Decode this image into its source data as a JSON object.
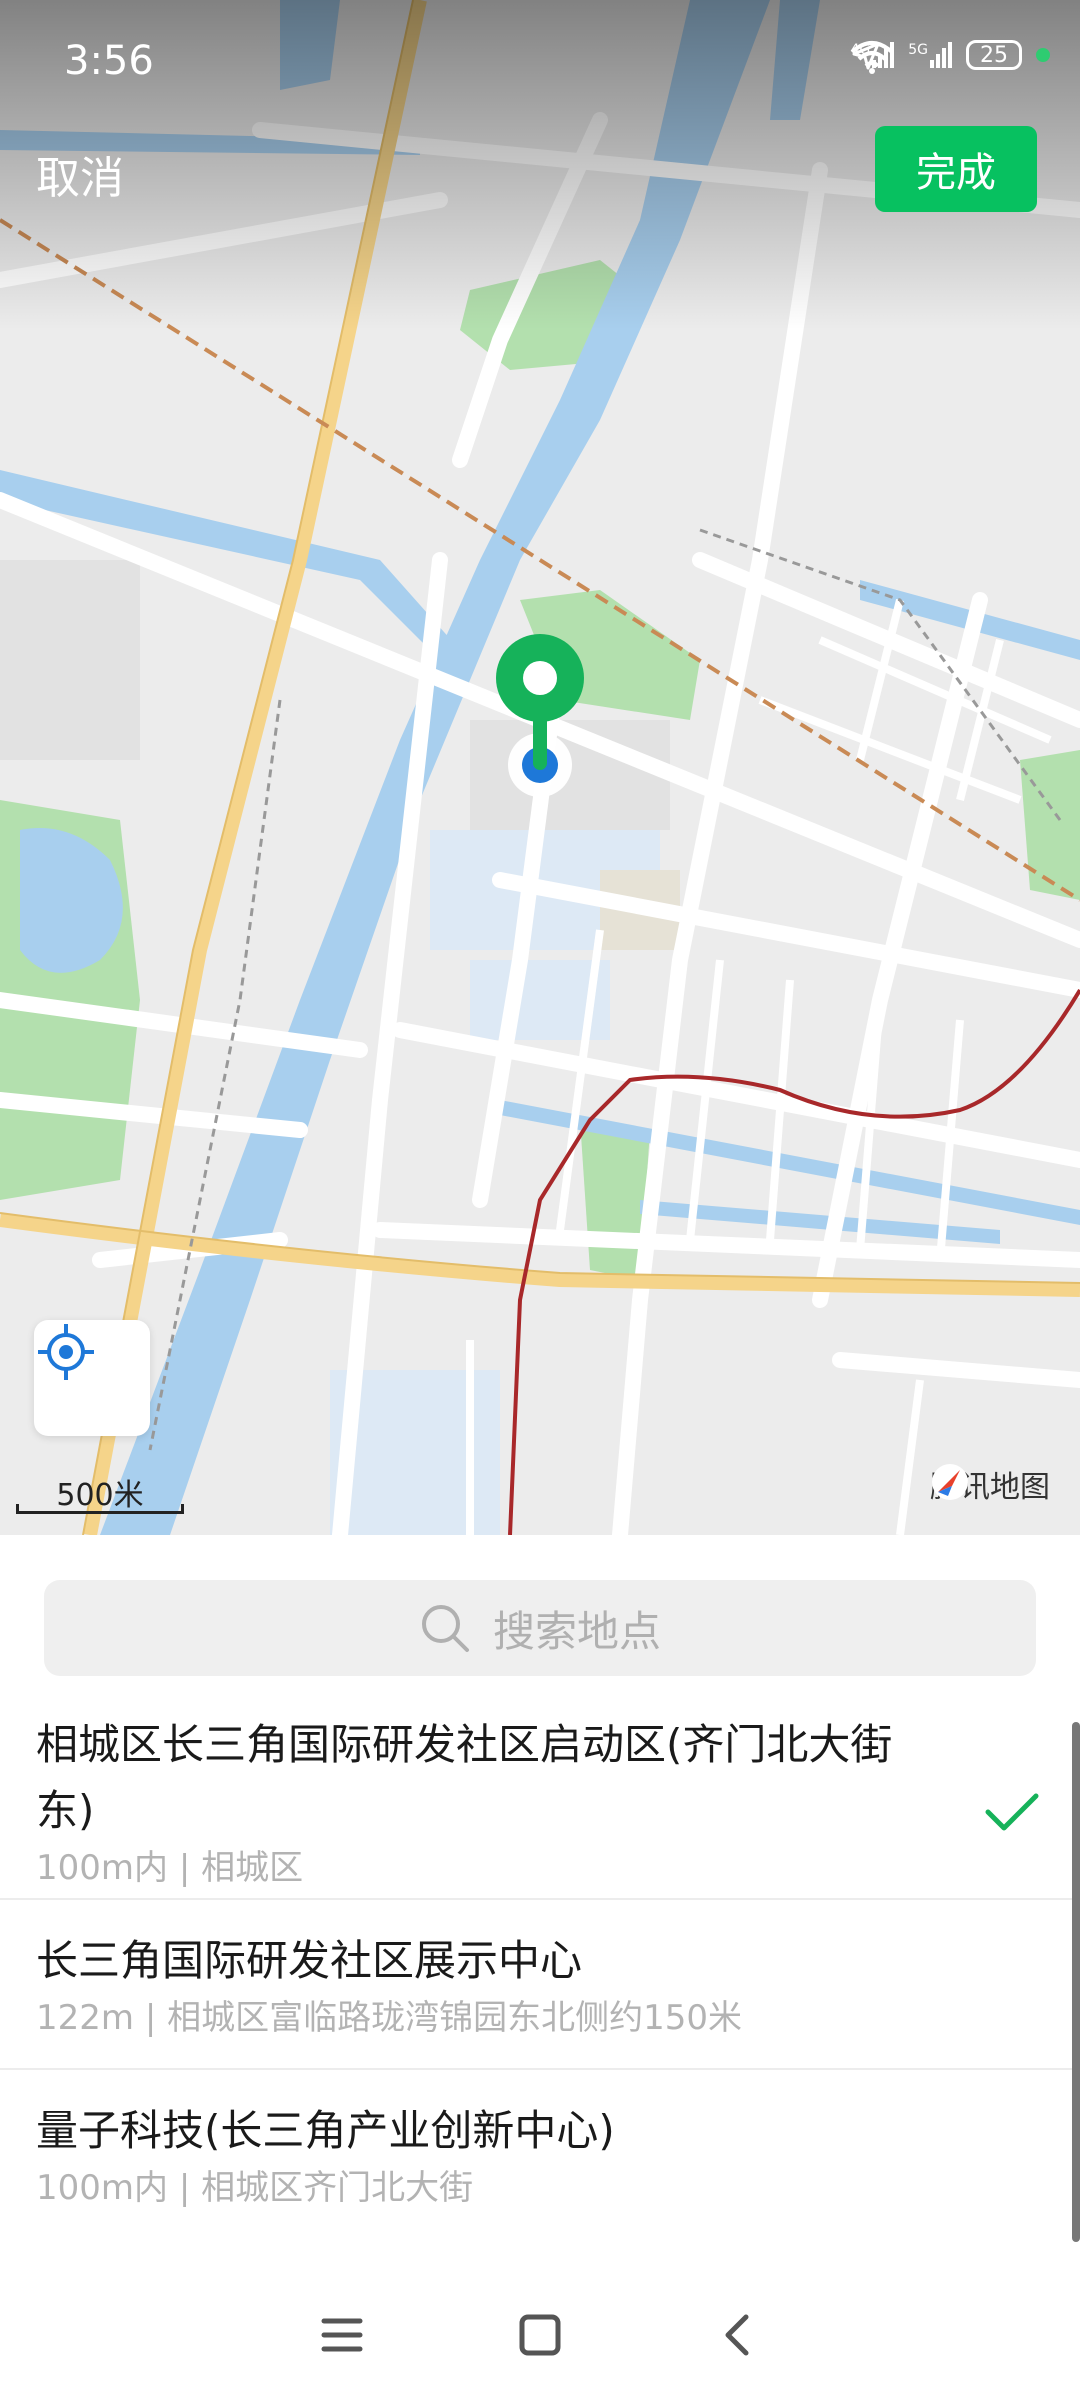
{
  "status_bar": {
    "time": "3:56",
    "signal_1": "4G",
    "signal_2": "5G",
    "battery": "25"
  },
  "header": {
    "cancel_label": "取消",
    "done_label": "完成"
  },
  "map": {
    "scale_label": "500米",
    "provider": "腾讯地图"
  },
  "search": {
    "placeholder": "搜索地点"
  },
  "results": [
    {
      "title": "相城区长三角国际研发社区启动区(齐门北大街东)",
      "subtitle": "100m内 | 相城区",
      "selected": true
    },
    {
      "title": "长三角国际研发社区展示中心",
      "subtitle": "122m | 相城区富临路珑湾锦园东北侧约150米",
      "selected": false
    },
    {
      "title": "量子科技(长三角产业创新中心)",
      "subtitle": "100m内 | 相城区齐门北大街",
      "selected": false
    }
  ],
  "colors": {
    "accent": "#07c160",
    "water": "#a8cfee",
    "park": "#b3e0ae",
    "highway": "#f5d48a",
    "metro": "#a8282a",
    "pin": "#16b25a",
    "user_dot": "#1e78d8"
  },
  "icons": {
    "location": "crosshair-icon",
    "search": "search-icon",
    "check": "check-icon"
  }
}
